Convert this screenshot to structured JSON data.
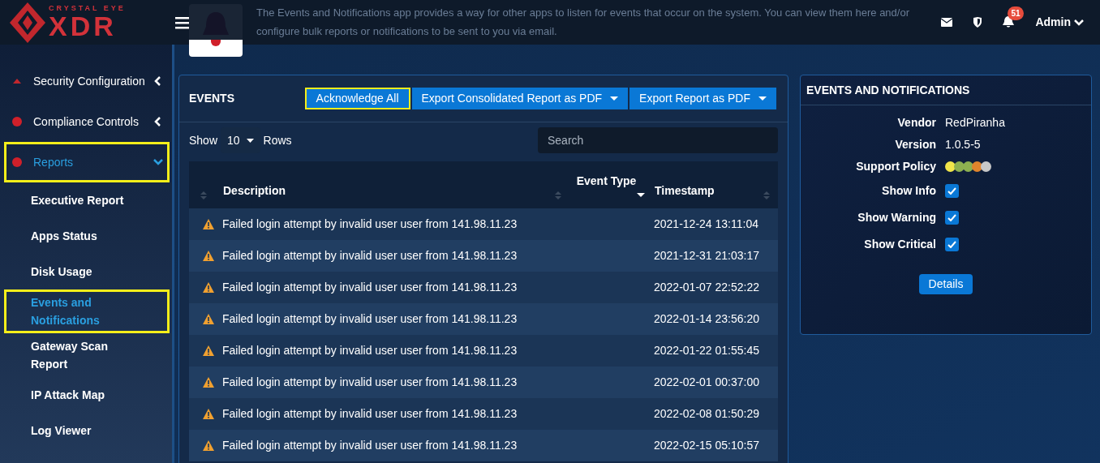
{
  "header": {
    "logo_small": "CRYSTAL EYE",
    "logo_large": "XDR",
    "description": "The Events and Notifications app provides a way for other apps to listen for events that occur on the system. You can view them here and/or configure bulk reports or notifications to be sent to you via email.",
    "notification_count": "51",
    "user": "Admin"
  },
  "sidebar": {
    "items": [
      {
        "label": "Security Configuration",
        "kind": "section",
        "expanded": false,
        "selected": false,
        "highlighted": false
      },
      {
        "label": "Compliance Controls",
        "kind": "section",
        "expanded": false,
        "selected": false,
        "highlighted": false
      },
      {
        "label": "Reports",
        "kind": "section",
        "expanded": true,
        "selected": true,
        "highlighted": true
      },
      {
        "label": "Executive Report",
        "kind": "link",
        "selected": false,
        "highlighted": false
      },
      {
        "label": "Apps Status",
        "kind": "link",
        "selected": false,
        "highlighted": false
      },
      {
        "label": "Disk Usage",
        "kind": "link",
        "selected": false,
        "highlighted": false
      },
      {
        "label": "Events and Notifications",
        "kind": "link",
        "selected": true,
        "highlighted": true
      },
      {
        "label": "Gateway Scan Report",
        "kind": "link",
        "selected": false,
        "highlighted": false
      },
      {
        "label": "IP Attack Map",
        "kind": "link",
        "selected": false,
        "highlighted": false
      },
      {
        "label": "Log Viewer",
        "kind": "link",
        "selected": false,
        "highlighted": false
      }
    ]
  },
  "events": {
    "title": "EVENTS",
    "buttons": [
      {
        "label": "Acknowledge All",
        "dropdown": false,
        "highlighted": true
      },
      {
        "label": "Export Consolidated Report as PDF",
        "dropdown": true,
        "highlighted": false
      },
      {
        "label": "Export Report as PDF",
        "dropdown": true,
        "highlighted": false
      }
    ],
    "show_label": "Show",
    "page_size": "10",
    "rows_label": "Rows",
    "search": {
      "placeholder": "Search"
    },
    "table": {
      "columns": [
        "Description",
        "Event Type",
        "Timestamp"
      ],
      "rows": [
        {
          "description": "Failed login attempt by invalid user user from 141.98.11.23",
          "timestamp": "2021-12-24 13:11:04"
        },
        {
          "description": "Failed login attempt by invalid user user from 141.98.11.23",
          "timestamp": "2021-12-31 21:03:17"
        },
        {
          "description": "Failed login attempt by invalid user user from 141.98.11.23",
          "timestamp": "2022-01-07 22:52:22"
        },
        {
          "description": "Failed login attempt by invalid user user from 141.98.11.23",
          "timestamp": "2022-01-14 23:56:20"
        },
        {
          "description": "Failed login attempt by invalid user user from 141.98.11.23",
          "timestamp": "2022-01-22 01:55:45"
        },
        {
          "description": "Failed login attempt by invalid user user from 141.98.11.23",
          "timestamp": "2022-02-01 00:37:00"
        },
        {
          "description": "Failed login attempt by invalid user user from 141.98.11.23",
          "timestamp": "2022-02-08 01:50:29"
        },
        {
          "description": "Failed login attempt by invalid user user from 141.98.11.23",
          "timestamp": "2022-02-15 05:10:57"
        }
      ]
    }
  },
  "app_info": {
    "title": "EVENTS AND NOTIFICATIONS",
    "fields": [
      {
        "label": "Vendor",
        "value": "RedPiranha"
      },
      {
        "label": "Version",
        "value": "1.0.5-5"
      }
    ],
    "support_policy": {
      "label": "Support Policy",
      "dots": [
        {
          "color": "#f0e54a"
        },
        {
          "color": "#8db050"
        },
        {
          "color": "#8db050"
        },
        {
          "color": "#e0842c"
        },
        {
          "color": "#c8c8c8"
        }
      ]
    },
    "toggles": [
      {
        "label": "Show Info",
        "checked": true
      },
      {
        "label": "Show Warning",
        "checked": true
      },
      {
        "label": "Show Critical",
        "checked": true
      }
    ],
    "button": "Details"
  }
}
